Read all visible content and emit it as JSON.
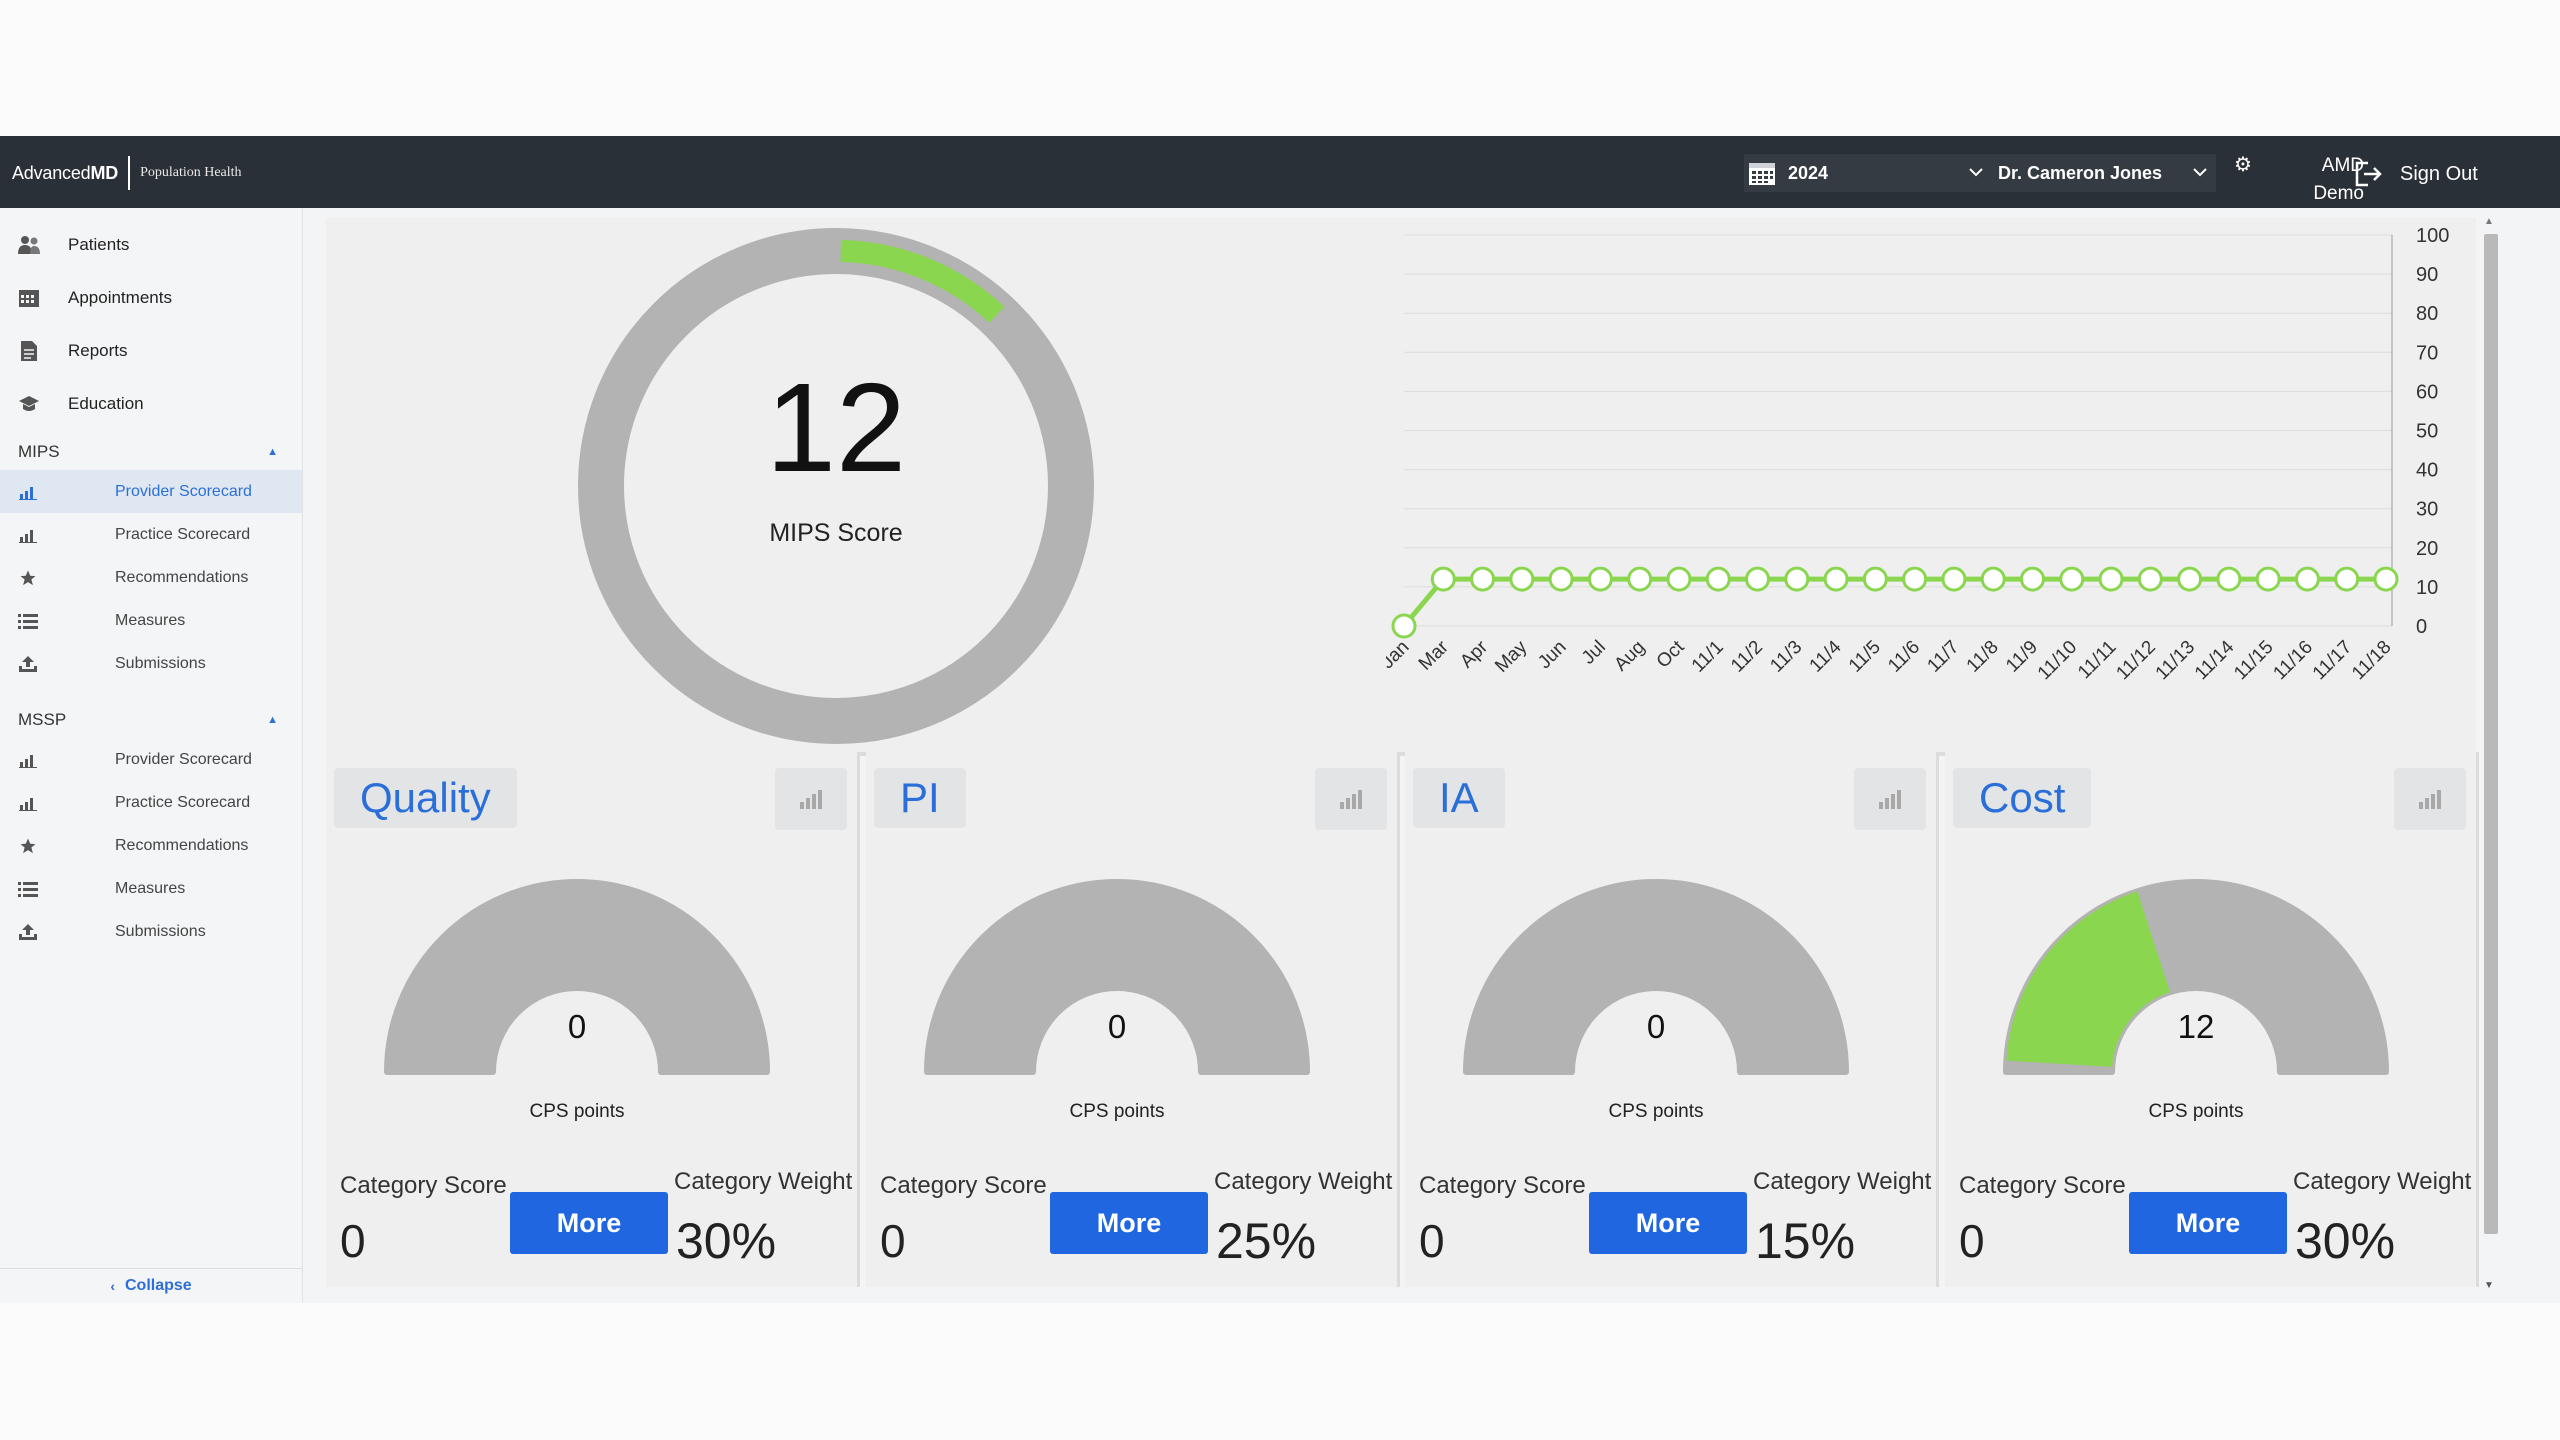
{
  "topbar": {
    "brand_prefix": "Advanced",
    "brand_bold": "MD",
    "brand_sub": "Population Health",
    "year": "2024",
    "provider": "Dr. Cameron Jones",
    "account_line1": "AMD",
    "account_line2": "Demo",
    "signout_label": "Sign Out"
  },
  "sidebar": {
    "nav": [
      {
        "label": "Patients",
        "icon": "users-icon"
      },
      {
        "label": "Appointments",
        "icon": "calendar-icon"
      },
      {
        "label": "Reports",
        "icon": "document-icon"
      },
      {
        "label": "Education",
        "icon": "graduation-cap-icon"
      }
    ],
    "mips": {
      "title": "MIPS",
      "items": [
        {
          "label": "Provider Scorecard",
          "icon": "bar-chart-icon",
          "active": true
        },
        {
          "label": "Practice Scorecard",
          "icon": "bar-chart-icon"
        },
        {
          "label": "Recommendations",
          "icon": "star-icon"
        },
        {
          "label": "Measures",
          "icon": "list-icon"
        },
        {
          "label": "Submissions",
          "icon": "upload-icon"
        }
      ]
    },
    "mssp": {
      "title": "MSSP",
      "items": [
        {
          "label": "Provider Scorecard",
          "icon": "bar-chart-icon"
        },
        {
          "label": "Practice Scorecard",
          "icon": "bar-chart-icon"
        },
        {
          "label": "Recommendations",
          "icon": "star-icon"
        },
        {
          "label": "Measures",
          "icon": "list-icon"
        },
        {
          "label": "Submissions",
          "icon": "upload-icon"
        }
      ]
    },
    "collapse_label": "Collapse"
  },
  "mips_score": {
    "value": "12",
    "label": "MIPS Score",
    "max": 100,
    "colors": {
      "fill": "#8bd64f",
      "track": "#b3b3b3"
    }
  },
  "chart_data": {
    "type": "line",
    "x": [
      "Jan",
      "Mar",
      "Apr",
      "May",
      "Jun",
      "Jul",
      "Aug",
      "Oct",
      "11/1",
      "11/2",
      "11/3",
      "11/4",
      "11/5",
      "11/6",
      "11/7",
      "11/8",
      "11/9",
      "11/10",
      "11/11",
      "11/12",
      "11/13",
      "11/14",
      "11/15",
      "11/16",
      "11/17",
      "11/18"
    ],
    "series": [
      {
        "values": [
          0,
          12,
          12,
          12,
          12,
          12,
          12,
          12,
          12,
          12,
          12,
          12,
          12,
          12,
          12,
          12,
          12,
          12,
          12,
          12,
          12,
          12,
          12,
          12,
          12,
          12
        ],
        "color": "#8bd64f"
      }
    ],
    "ylim": [
      0,
      100
    ],
    "yticks": [
      0,
      10,
      20,
      30,
      40,
      50,
      60,
      70,
      80,
      90,
      100
    ],
    "y_axis_side": "right",
    "grid": true,
    "title": "",
    "xlabel": "",
    "ylabel": ""
  },
  "categories": [
    {
      "title": "Quality",
      "points": "0",
      "cps_label": "CPS points",
      "score_label": "Category Score",
      "score": "0",
      "more_label": "More",
      "weight_label": "Category Weight",
      "weight": "30%",
      "points_max": 30
    },
    {
      "title": "PI",
      "points": "0",
      "cps_label": "CPS points",
      "score_label": "Category Score",
      "score": "0",
      "more_label": "More",
      "weight_label": "Category Weight",
      "weight": "25%",
      "points_max": 25
    },
    {
      "title": "IA",
      "points": "0",
      "cps_label": "CPS points",
      "score_label": "Category Score",
      "score": "0",
      "more_label": "More",
      "weight_label": "Category Weight",
      "weight": "15%",
      "points_max": 15
    },
    {
      "title": "Cost",
      "points": "12",
      "cps_label": "CPS points",
      "score_label": "Category Score",
      "score": "0",
      "more_label": "More",
      "weight_label": "Category Weight",
      "weight": "30%",
      "points_max": 30
    }
  ]
}
